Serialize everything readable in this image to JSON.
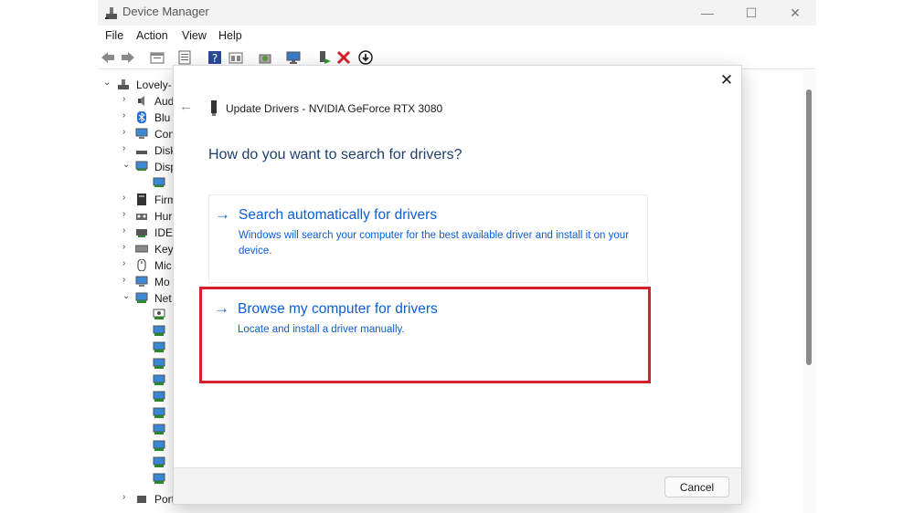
{
  "window": {
    "title": "Device Manager",
    "controls": {
      "minimize": "—",
      "maximize": "☐",
      "close": "✕"
    }
  },
  "menu": [
    "File",
    "Action",
    "View",
    "Help"
  ],
  "toolbar_icons": [
    "back-icon",
    "forward-icon",
    "properties-icon",
    "show-hidden-icon",
    "help-icon",
    "view-icon",
    "update-driver-icon",
    "scan-hardware-icon",
    "enable-device-icon",
    "uninstall-device-icon",
    "download-icon"
  ],
  "tree": {
    "root": "Lovely-",
    "items": [
      "Aud",
      "Blu",
      "Con",
      "Disk",
      "Disp",
      "Firm",
      "Hur",
      "IDE",
      "Key",
      "Mic",
      "Mo",
      "Net",
      "Port"
    ]
  },
  "dialog": {
    "close": "✕",
    "back": "←",
    "title": "Update Drivers - NVIDIA GeForce RTX 3080",
    "heading": "How do you want to search for drivers?",
    "arrow": "→",
    "options": [
      {
        "title": "Search automatically for drivers",
        "desc": "Windows will search your computer for the best available driver and install it on your device."
      },
      {
        "title": "Browse my computer for drivers",
        "desc": "Locate and install a driver manually."
      }
    ],
    "cancel": "Cancel"
  },
  "colors": {
    "accent": "#0b5ed7",
    "heading": "#1f3f6e",
    "highlight": "#d4202a"
  }
}
